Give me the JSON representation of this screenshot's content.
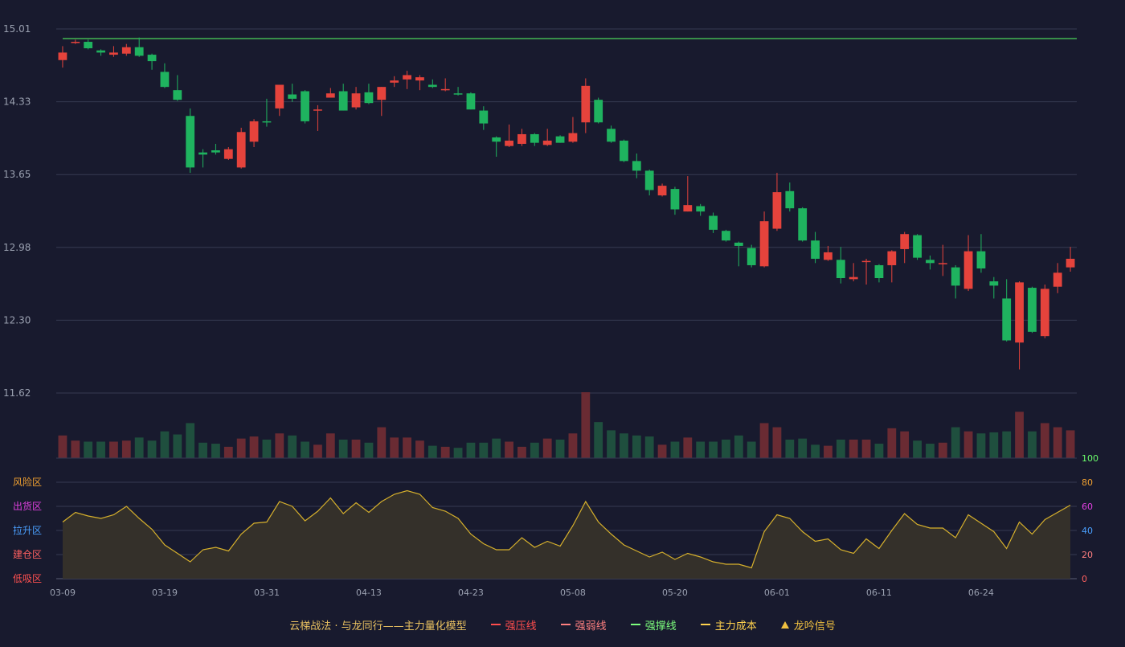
{
  "chart_data": {
    "type": "candlestick",
    "price_axis": {
      "ticks": [
        "15.01",
        "14.33",
        "13.65",
        "12.98",
        "12.30",
        "11.62"
      ],
      "range": [
        11.62,
        15.01
      ]
    },
    "indicator_axis": {
      "ticks": [
        "0",
        "20",
        "40",
        "60",
        "80",
        "100"
      ],
      "range": [
        0,
        100
      ]
    },
    "zones": [
      {
        "label": "风险区",
        "color": "#f0a030"
      },
      {
        "label": "出货区",
        "color": "#e040e0"
      },
      {
        "label": "拉升区",
        "color": "#4aa0ff"
      },
      {
        "label": "建仓区",
        "color": "#ff6060"
      },
      {
        "label": "低吸区",
        "color": "#ff5050"
      }
    ],
    "x_ticks": [
      {
        "index": 0,
        "label": "03-09"
      },
      {
        "index": 8,
        "label": "03-19"
      },
      {
        "index": 16,
        "label": "03-31"
      },
      {
        "index": 24,
        "label": "04-13"
      },
      {
        "index": 32,
        "label": "04-23"
      },
      {
        "index": 40,
        "label": "05-08"
      },
      {
        "index": 48,
        "label": "05-20"
      },
      {
        "index": 56,
        "label": "06-01"
      },
      {
        "index": 64,
        "label": "06-11"
      },
      {
        "index": 72,
        "label": "06-24"
      }
    ],
    "reference_line": 14.92,
    "candles": [
      [
        14.72,
        14.79,
        14.65,
        14.85
      ],
      [
        14.89,
        14.89,
        14.87,
        14.91
      ],
      [
        14.89,
        14.83,
        14.82,
        14.91
      ],
      [
        14.81,
        14.79,
        14.76,
        14.82
      ],
      [
        14.77,
        14.79,
        14.75,
        14.85
      ],
      [
        14.78,
        14.84,
        14.76,
        14.87
      ],
      [
        14.84,
        14.76,
        14.75,
        14.93
      ],
      [
        14.77,
        14.71,
        14.63,
        14.78
      ],
      [
        14.61,
        14.47,
        14.46,
        14.69
      ],
      [
        14.44,
        14.35,
        14.34,
        14.58
      ],
      [
        14.2,
        13.72,
        13.67,
        14.27
      ],
      [
        13.86,
        13.84,
        13.72,
        13.89
      ],
      [
        13.88,
        13.86,
        13.84,
        13.94
      ],
      [
        13.8,
        13.89,
        13.79,
        13.91
      ],
      [
        13.72,
        14.05,
        13.71,
        14.09
      ],
      [
        13.96,
        14.15,
        13.91,
        14.17
      ],
      [
        14.15,
        14.14,
        14.1,
        14.36
      ],
      [
        14.27,
        14.49,
        14.2,
        14.49
      ],
      [
        14.4,
        14.36,
        14.33,
        14.5
      ],
      [
        14.43,
        14.15,
        14.13,
        14.44
      ],
      [
        14.26,
        14.26,
        14.06,
        14.3
      ],
      [
        14.37,
        14.41,
        14.37,
        14.46
      ],
      [
        14.43,
        14.25,
        14.25,
        14.5
      ],
      [
        14.28,
        14.41,
        14.26,
        14.47
      ],
      [
        14.42,
        14.32,
        14.31,
        14.5
      ],
      [
        14.35,
        14.47,
        14.2,
        14.47
      ],
      [
        14.51,
        14.53,
        14.47,
        14.57
      ],
      [
        14.54,
        14.58,
        14.45,
        14.62
      ],
      [
        14.53,
        14.56,
        14.44,
        14.58
      ],
      [
        14.49,
        14.47,
        14.46,
        14.54
      ],
      [
        14.44,
        14.45,
        14.43,
        14.55
      ],
      [
        14.41,
        14.4,
        14.39,
        14.47
      ],
      [
        14.41,
        14.26,
        14.26,
        14.42
      ],
      [
        14.25,
        14.13,
        14.07,
        14.29
      ],
      [
        14.0,
        13.96,
        13.82,
        14.01
      ],
      [
        13.92,
        13.97,
        13.91,
        14.12
      ],
      [
        13.94,
        14.03,
        13.92,
        14.08
      ],
      [
        14.03,
        13.95,
        13.92,
        14.04
      ],
      [
        13.93,
        13.97,
        13.92,
        14.08
      ],
      [
        14.01,
        13.95,
        13.95,
        14.02
      ],
      [
        13.96,
        14.04,
        13.95,
        14.19
      ],
      [
        14.14,
        14.48,
        14.04,
        14.55
      ],
      [
        14.35,
        14.14,
        14.13,
        14.37
      ],
      [
        14.08,
        13.96,
        13.95,
        14.11
      ],
      [
        13.97,
        13.78,
        13.77,
        13.98
      ],
      [
        13.78,
        13.69,
        13.62,
        13.85
      ],
      [
        13.69,
        13.51,
        13.46,
        13.7
      ],
      [
        13.46,
        13.55,
        13.45,
        13.57
      ],
      [
        13.52,
        13.33,
        13.28,
        13.54
      ],
      [
        13.31,
        13.37,
        13.31,
        13.64
      ],
      [
        13.36,
        13.31,
        13.27,
        13.38
      ],
      [
        13.27,
        13.14,
        13.11,
        13.3
      ],
      [
        13.13,
        13.04,
        13.03,
        13.14
      ],
      [
        13.02,
        12.99,
        12.8,
        13.03
      ],
      [
        12.97,
        12.81,
        12.79,
        13.0
      ],
      [
        12.8,
        13.22,
        12.79,
        13.31
      ],
      [
        13.15,
        13.49,
        13.13,
        13.67
      ],
      [
        13.5,
        13.34,
        13.31,
        13.58
      ],
      [
        13.34,
        13.04,
        13.03,
        13.35
      ],
      [
        13.04,
        12.87,
        12.83,
        13.12
      ],
      [
        12.86,
        12.93,
        12.85,
        12.99
      ],
      [
        12.86,
        12.69,
        12.64,
        12.98
      ],
      [
        12.68,
        12.7,
        12.66,
        12.83
      ],
      [
        12.84,
        12.85,
        12.63,
        12.87
      ],
      [
        12.81,
        12.69,
        12.65,
        12.82
      ],
      [
        12.81,
        12.94,
        12.65,
        12.95
      ],
      [
        12.96,
        13.1,
        12.83,
        13.12
      ],
      [
        13.09,
        12.88,
        12.86,
        13.1
      ],
      [
        12.86,
        12.83,
        12.77,
        12.9
      ],
      [
        12.83,
        12.83,
        12.71,
        13.0
      ],
      [
        12.79,
        12.62,
        12.5,
        12.81
      ],
      [
        12.59,
        12.94,
        12.57,
        13.09
      ],
      [
        12.94,
        12.78,
        12.74,
        13.1
      ],
      [
        12.66,
        12.62,
        12.5,
        12.7
      ],
      [
        12.5,
        12.11,
        12.1,
        12.68
      ],
      [
        12.09,
        12.65,
        11.84,
        12.66
      ],
      [
        12.6,
        12.19,
        12.18,
        12.61
      ],
      [
        12.15,
        12.59,
        12.13,
        12.63
      ],
      [
        12.61,
        12.74,
        12.55,
        12.83
      ],
      [
        12.79,
        12.87,
        12.75,
        12.98
      ]
    ],
    "volumes": [
      22,
      17,
      16,
      16,
      16,
      17,
      20,
      17,
      26,
      23,
      34,
      15,
      14,
      11,
      19,
      21,
      18,
      24,
      22,
      16,
      13,
      24,
      18,
      18,
      15,
      30,
      20,
      20,
      17,
      12,
      11,
      10,
      15,
      15,
      19,
      16,
      11,
      15,
      19,
      18,
      24,
      64,
      35,
      27,
      24,
      22,
      21,
      13,
      16,
      20,
      16,
      16,
      18,
      22,
      16,
      34,
      30,
      18,
      19,
      13,
      12,
      18,
      18,
      18,
      14,
      29,
      26,
      17,
      14,
      15,
      30,
      26,
      24,
      25,
      26,
      45,
      26,
      34,
      30,
      27
    ],
    "indicator": [
      47,
      55,
      52,
      50,
      53,
      60,
      50,
      41,
      28,
      21,
      14,
      24,
      26,
      23,
      37,
      46,
      47,
      64,
      60,
      48,
      56,
      67,
      54,
      63,
      55,
      64,
      70,
      73,
      70,
      59,
      56,
      50,
      37,
      29,
      24,
      24,
      34,
      26,
      31,
      27,
      44,
      64,
      47,
      37,
      28,
      23,
      18,
      22,
      16,
      21,
      18,
      14,
      12,
      12,
      9,
      39,
      53,
      50,
      39,
      31,
      33,
      24,
      21,
      33,
      25,
      40,
      54,
      45,
      42,
      42,
      34,
      53,
      46,
      39,
      25,
      47,
      37,
      49,
      55,
      61
    ]
  },
  "colors": {
    "background": "#181a2e",
    "up": "#e5433c",
    "down": "#1fb35f",
    "up_volume": "#6a2b33",
    "down_volume": "#1f4f3e",
    "grid": "#363a52",
    "reference_line": "#4cd45a",
    "indicator_line": "#d6b02c",
    "indicator_fill": "#34302a",
    "axis_text": "#9aa0b0"
  },
  "legend": [
    {
      "label": "云梯战法 · 与龙同行——主力量化模型",
      "color": "#e8c060",
      "marker": "none"
    },
    {
      "label": "强压线",
      "color": "#ff4d4d",
      "marker": "solid"
    },
    {
      "label": "强弱线",
      "color": "#ff8080",
      "marker": "dashed"
    },
    {
      "label": "强撑线",
      "color": "#7dff7d",
      "marker": "solid"
    },
    {
      "label": "主力成本",
      "color": "#ffd24d",
      "marker": "dashed"
    },
    {
      "label": "龙吟信号",
      "color": "#f0c040",
      "marker": "triangle"
    }
  ]
}
